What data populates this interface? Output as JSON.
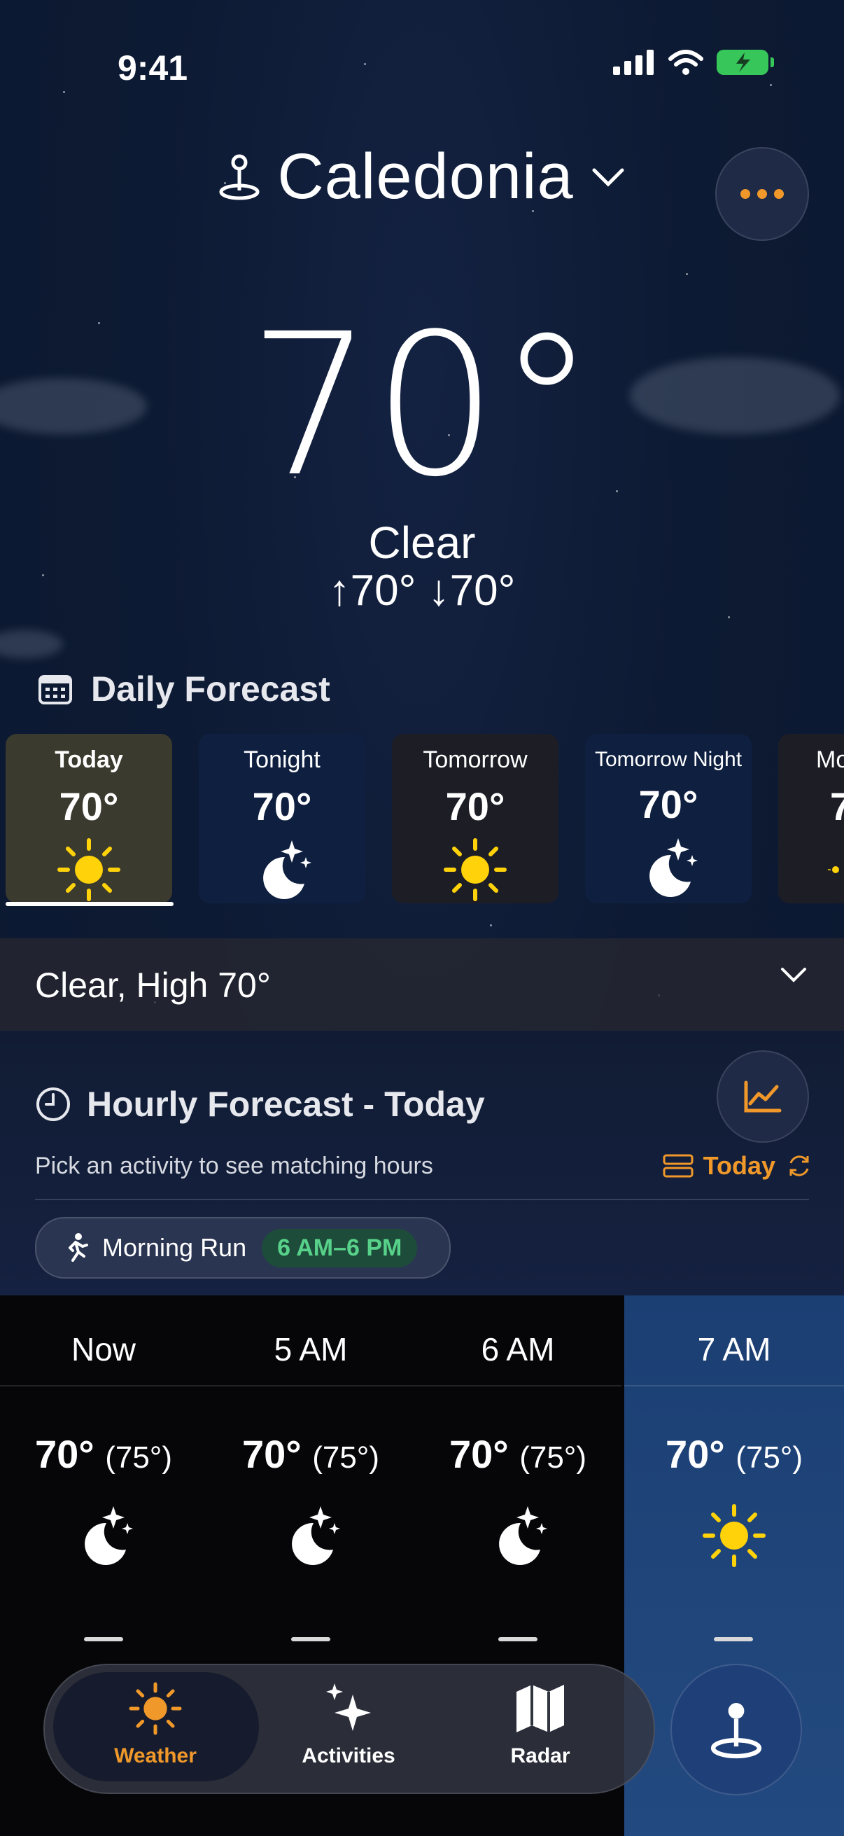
{
  "status": {
    "time": "9:41"
  },
  "location": {
    "name": "Caledonia"
  },
  "current": {
    "temp": "70°",
    "condition": "Clear",
    "high_low": "↑70°  ↓70°"
  },
  "daily": {
    "title": "Daily Forecast",
    "cards": [
      {
        "label": "Today",
        "temp": "70°",
        "icon": "sun-icon"
      },
      {
        "label": "Tonight",
        "temp": "70°",
        "icon": "moon-stars-icon"
      },
      {
        "label": "Tomorrow",
        "temp": "70°",
        "icon": "sun-icon"
      },
      {
        "label": "Tomorrow Night",
        "temp": "70°",
        "icon": "moon-stars-icon"
      },
      {
        "label": "Mo",
        "temp": "7",
        "icon": "sun-icon"
      }
    ],
    "summary": "Clear, High 70°"
  },
  "hourly": {
    "title": "Hourly Forecast - Today",
    "subtitle": "Pick an activity to see matching hours",
    "toggle_label": "Today",
    "activity": {
      "label": "Morning Run",
      "range": "6 AM–6 PM"
    },
    "hours": [
      {
        "time": "Now",
        "temp": "70°",
        "feels": "(75°)",
        "icon": "moon-stars-icon"
      },
      {
        "time": "5 AM",
        "temp": "70°",
        "feels": "(75°)",
        "icon": "moon-stars-icon"
      },
      {
        "time": "6 AM",
        "temp": "70°",
        "feels": "(75°)",
        "icon": "moon-stars-icon"
      },
      {
        "time": "7 AM",
        "temp": "70°",
        "feels": "(75°)",
        "icon": "sun-icon"
      }
    ]
  },
  "tabs": [
    {
      "label": "Weather",
      "icon": "sun-icon"
    },
    {
      "label": "Activities",
      "icon": "sparkles-icon"
    },
    {
      "label": "Radar",
      "icon": "map-icon"
    }
  ],
  "colors": {
    "accent": "#f0982a",
    "sun": "#ffd20a",
    "run_green": "#58d28a"
  }
}
